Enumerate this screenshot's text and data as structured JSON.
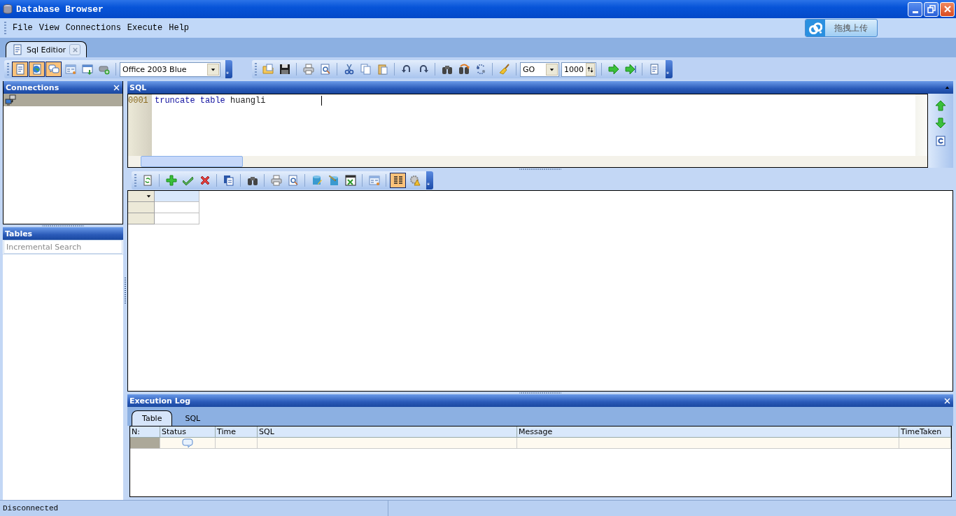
{
  "window": {
    "title": "Database Browser"
  },
  "menu": [
    "File",
    "View",
    "Connections",
    "Execute",
    "Help"
  ],
  "upload_button": {
    "label": "拖拽上传"
  },
  "editor_tabs": [
    {
      "label": "Sql Editior",
      "selected": true
    }
  ],
  "main_toolbar": {
    "buttons": [
      {
        "pressed": true
      },
      {
        "pressed": true
      },
      {
        "pressed": true
      },
      {
        "pressed": false
      },
      {
        "pressed": false
      },
      {
        "pressed": false
      }
    ],
    "theme_select": "Office 2003 Blue"
  },
  "sql_toolbar": {
    "execute_select": "GO",
    "row_limit": "1000"
  },
  "connections": {
    "title": "Connections",
    "items": [
      {
        "selected": true
      }
    ]
  },
  "tables": {
    "title": "Tables",
    "search": {
      "placeholder": "Incremental Search"
    }
  },
  "sql_panel": {
    "title": "SQL",
    "lines": [
      {
        "number": "0001",
        "tokens": [
          {
            "kind": "keyword",
            "text": "truncate"
          },
          {
            "kind": "keyword",
            "text": "table"
          },
          {
            "kind": "name",
            "text": "huangli"
          }
        ]
      }
    ]
  },
  "grid_toolbar": {
    "buttons": [
      {
        "pressed": false
      },
      {
        "pressed": false
      },
      {
        "pressed": false
      },
      {
        "pressed": false
      },
      {
        "pressed": false
      },
      {
        "pressed": false
      },
      {
        "pressed": false
      },
      {
        "pressed": false
      },
      {
        "pressed": false
      },
      {
        "pressed": false
      },
      {
        "pressed": false
      },
      {
        "pressed": false
      },
      {
        "pressed": true
      },
      {
        "pressed": false
      }
    ]
  },
  "execution_log": {
    "title": "Execution Log",
    "tabs": [
      {
        "label": "Table",
        "selected": true
      },
      {
        "label": "SQL",
        "selected": false
      }
    ],
    "columns": [
      "N:",
      "Status",
      "Time",
      "SQL",
      "Message",
      "TimeTaken"
    ]
  },
  "status_bar": {
    "text": "Disconnected"
  }
}
